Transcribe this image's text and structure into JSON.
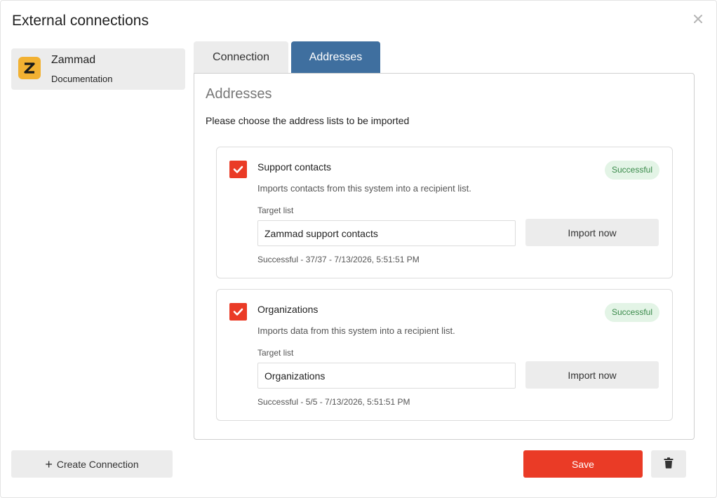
{
  "dialog": {
    "title": "External connections",
    "close_icon": "close-icon"
  },
  "sidebar": {
    "connections": [
      {
        "logo_letter": "Z",
        "logo_color": "#f2b132",
        "name": "Zammad",
        "subtitle": "Documentation"
      }
    ],
    "create_label": "Create Connection"
  },
  "tabs": [
    {
      "label": "Connection",
      "active": false
    },
    {
      "label": "Addresses",
      "active": true
    }
  ],
  "addresses": {
    "title": "Addresses",
    "description": "Please choose the address lists to be imported",
    "lists": [
      {
        "checked": true,
        "title": "Support contacts",
        "badge": "Successful",
        "description": "Imports contacts from this system into a recipient list.",
        "target_label": "Target list",
        "target_value": "Zammad support contacts",
        "import_label": "Import now",
        "status": "Successful - 37/37 - 7/13/2026, 5:51:51 PM"
      },
      {
        "checked": true,
        "title": "Organizations",
        "badge": "Successful",
        "description": "Imports data from this system into a recipient list.",
        "target_label": "Target list",
        "target_value": "Organizations",
        "import_label": "Import now",
        "status": "Successful - 5/5 - 7/13/2026, 5:51:51 PM"
      }
    ]
  },
  "footer": {
    "save_label": "Save",
    "delete_icon": "trash-icon"
  },
  "colors": {
    "accent": "#ea3b26",
    "active_tab": "#3f6f9f",
    "success_text": "#3a8a4a",
    "success_bg": "#e3f4e6"
  }
}
